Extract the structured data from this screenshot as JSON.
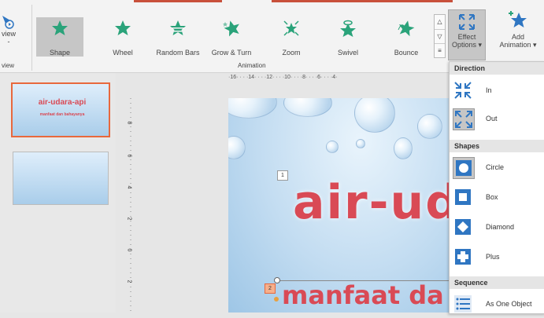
{
  "ribbon": {
    "preview_label_line1": "view",
    "preview_label_line2": "-",
    "preview_group_label": "view",
    "animation_group_label": "Animation",
    "effect_options_line1": "Effect",
    "effect_options_line2": "Options",
    "add_animation_line1": "Add",
    "add_animation_line2": "Animation",
    "gallery": [
      {
        "label": "Shape",
        "icon": "shape-star-icon"
      },
      {
        "label": "Wheel",
        "icon": "wheel-star-icon"
      },
      {
        "label": "Random Bars",
        "icon": "random-bars-star-icon"
      },
      {
        "label": "Grow & Turn",
        "icon": "grow-turn-star-icon"
      },
      {
        "label": "Zoom",
        "icon": "zoom-star-icon"
      },
      {
        "label": "Swivel",
        "icon": "swivel-star-icon"
      },
      {
        "label": "Bounce",
        "icon": "bounce-star-icon"
      }
    ],
    "accent_color": "#2aa37a",
    "selected_effect": "Shape"
  },
  "ruler": {
    "horizontal": "·16· · · ·14· · · ·12· · · ·10· · · ·8· · · ·6· · · ·4·",
    "vertical_ticks": [
      "8",
      "6",
      "4",
      "2",
      "0",
      "2"
    ]
  },
  "thumbnails": [
    {
      "title": "air-udara-api",
      "subtitle": "manfaat dan bahayanya"
    },
    {
      "title": "",
      "subtitle": ""
    }
  ],
  "slide": {
    "title": "air-ud",
    "subtitle": "manfaat da",
    "tag1": "1",
    "tag2": "2"
  },
  "effect_menu": {
    "direction_header": "Direction",
    "shapes_header": "Shapes",
    "sequence_header": "Sequence",
    "direction_items": [
      {
        "label": "In",
        "icon": "arrows-in-icon",
        "selected": false
      },
      {
        "label": "Out",
        "icon": "arrows-out-icon",
        "selected": true
      }
    ],
    "shape_items": [
      {
        "label": "Circle",
        "icon": "circle-shape-icon",
        "selected": true
      },
      {
        "label": "Box",
        "icon": "box-shape-icon",
        "selected": false
      },
      {
        "label": "Diamond",
        "icon": "diamond-shape-icon",
        "selected": false
      },
      {
        "label": "Plus",
        "icon": "plus-shape-icon",
        "selected": false
      }
    ],
    "sequence_items": [
      {
        "label": "As One Object",
        "icon": "list-icon",
        "selected": false
      }
    ],
    "icon_color": "#2f76c2"
  }
}
